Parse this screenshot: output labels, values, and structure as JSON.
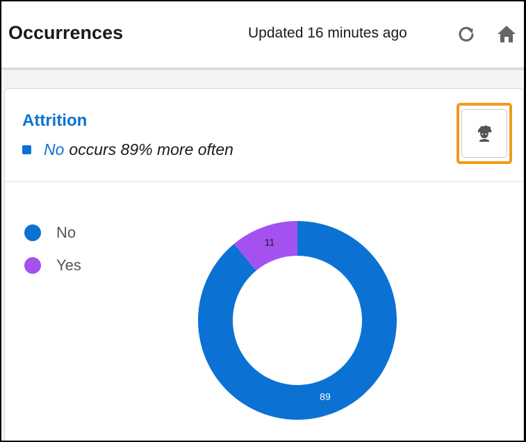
{
  "header": {
    "title": "Occurrences",
    "updated": "Updated 16 minutes ago",
    "refresh_icon": "refresh-icon",
    "home_icon": "home-icon"
  },
  "card": {
    "title": "Attrition",
    "insight": {
      "category": "No",
      "text": "occurs 89% more often",
      "color": "#0b72d3"
    },
    "einstein_icon": "einstein-icon"
  },
  "chart_data": {
    "type": "pie",
    "donut": true,
    "categories": [
      "No",
      "Yes"
    ],
    "values": [
      89,
      11
    ],
    "colors": [
      "#0b72d3",
      "#a352f0"
    ],
    "legend": "left",
    "data_labels": [
      "89",
      "11"
    ]
  }
}
